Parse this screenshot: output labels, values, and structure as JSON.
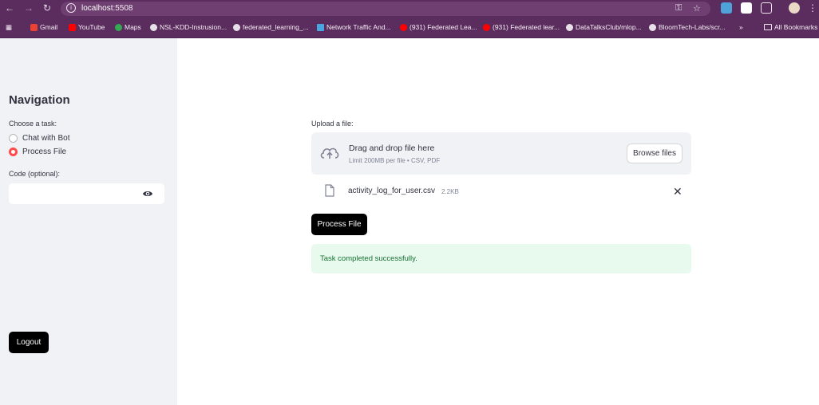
{
  "browser": {
    "url_host": "localhost",
    "url_port": ":5508",
    "all_bookmarks": "All Bookmarks",
    "more": "»",
    "bookmarks": [
      {
        "label": "Gmail"
      },
      {
        "label": "YouTube"
      },
      {
        "label": "Maps"
      },
      {
        "label": "NSL-KDD-Instrusion..."
      },
      {
        "label": "federated_learning_..."
      },
      {
        "label": "Network Traffic And..."
      },
      {
        "label": "(931) Federated Lea..."
      },
      {
        "label": "(931) Federated lear..."
      },
      {
        "label": "DataTalksClub/mlop..."
      },
      {
        "label": "BloomTech-Labs/scr..."
      }
    ]
  },
  "sidebar": {
    "title": "Navigation",
    "task_label": "Choose a task:",
    "options": [
      {
        "label": "Chat with Bot",
        "selected": false
      },
      {
        "label": "Process File",
        "selected": true
      }
    ],
    "code_label": "Code (optional):",
    "code_value": "",
    "logout": "Logout"
  },
  "main": {
    "upload_label": "Upload a file:",
    "dropzone_title": "Drag and drop file here",
    "dropzone_limit": "Limit 200MB per file • CSV, PDF",
    "browse": "Browse files",
    "file_name": "activity_log_for_user.csv",
    "file_size": "2.2KB",
    "process": "Process File",
    "success": "Task completed successfully."
  },
  "colors": {
    "accent": "#ff4b4b",
    "success_bg": "#e8f9ee",
    "success_text": "#177233",
    "chrome": "#5b2d5e"
  }
}
